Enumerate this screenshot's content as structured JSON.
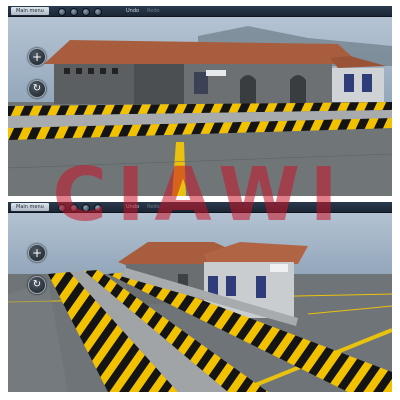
{
  "toolbar": {
    "main_menu_label": "Main menu",
    "undo_label": "Undo",
    "redo_label": "Redo"
  },
  "controls": {
    "zoom_icon": "plus-icon",
    "rotate_icon": "rotate-icon",
    "zoom_glyph": "+",
    "rotate_glyph": "↻"
  },
  "watermark": "CIAWI",
  "colors": {
    "sky": "#8fa3b8",
    "ground": "#6f7478",
    "roof": "#a85e3e",
    "wall": "#6b6e70",
    "hazard_yellow": "#f2c200",
    "hazard_black": "#141414",
    "line_yellow": "#e9c20e"
  }
}
